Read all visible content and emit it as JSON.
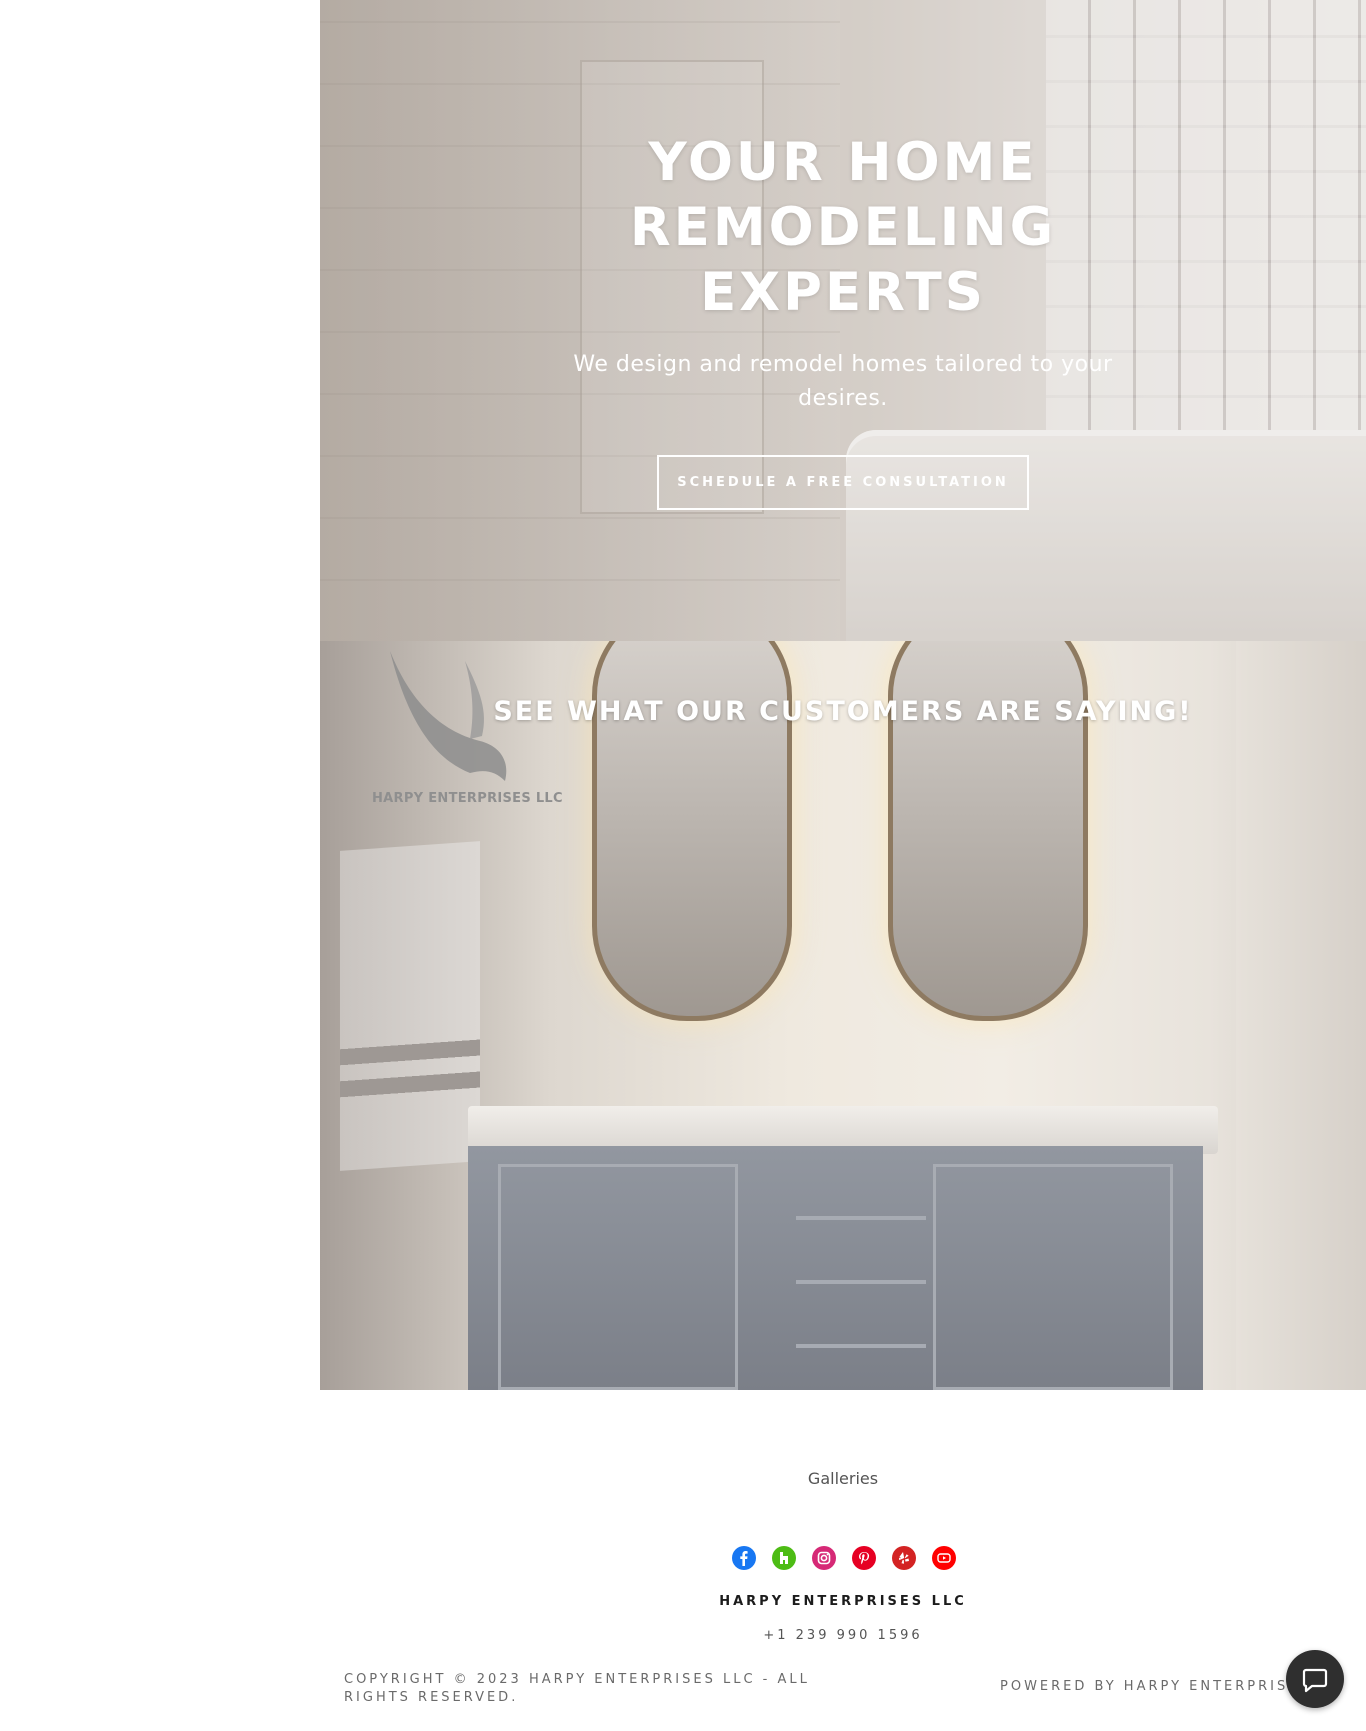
{
  "hero": {
    "title": "YOUR HOME\nREMODELING\nEXPERTS",
    "subtitle": "We design and remodel homes tailored to your desires.",
    "cta_label": "SCHEDULE A FREE CONSULTATION"
  },
  "testimonials": {
    "heading": "SEE WHAT OUR CUSTOMERS ARE SAYING!",
    "watermark_text": "HARPY ENTERPRISES LLC"
  },
  "footer": {
    "nav_link": "Galleries",
    "social_icons": [
      {
        "name": "facebook-icon",
        "color": "#1877f2"
      },
      {
        "name": "houzz-icon",
        "color": "#4dbc15"
      },
      {
        "name": "instagram-icon",
        "color": "#d62976"
      },
      {
        "name": "pinterest-icon",
        "color": "#e60023"
      },
      {
        "name": "yelp-icon",
        "color": "#d32323"
      },
      {
        "name": "youtube-icon",
        "color": "#ff0000"
      }
    ],
    "company_name": "HARPY ENTERPRISES LLC",
    "phone": "+1 239 990 1596",
    "copyright": "COPYRIGHT © 2023 HARPY ENTERPRISES LLC - ALL RIGHTS RESERVED.",
    "powered_by": "POWERED BY HARPY ENTERPRISES"
  }
}
